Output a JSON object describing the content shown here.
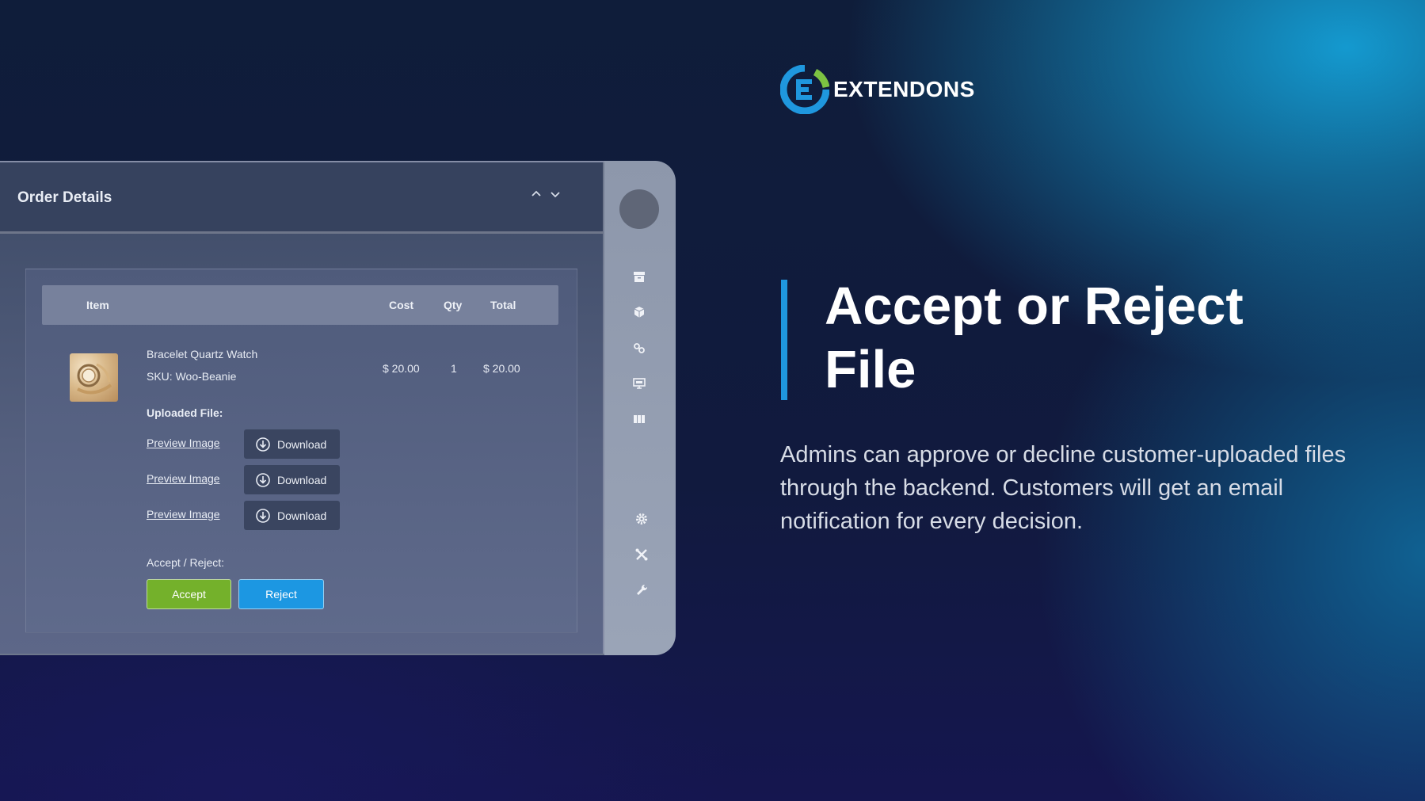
{
  "brand": {
    "name": "EXTENDONS",
    "logo_icon": "extendons-logo-icon",
    "colors": {
      "blue": "#1f97de",
      "green": "#7cc242"
    }
  },
  "hero": {
    "headline_line1": "Accept or Reject",
    "headline_line2": "File",
    "description": "Admins can approve or decline customer-uploaded files through the backend. Customers will get an email notification for every decision."
  },
  "panel": {
    "title": "Order Details",
    "collapse_icon": "chevron-up-icon",
    "expand_icon": "chevron-down-icon",
    "table": {
      "headers": {
        "item": "Item",
        "cost": "Cost",
        "qty": "Qty",
        "total": "Total"
      },
      "row": {
        "name": "Bracelet Quartz Watch",
        "sku": "SKU: Woo-Beanie",
        "cost": "$ 20.00",
        "qty": "1",
        "total": "$ 20.00"
      }
    },
    "uploaded_label": "Uploaded File:",
    "files": [
      {
        "preview": "Preview Image",
        "download": "Download"
      },
      {
        "preview": "Preview Image",
        "download": "Download"
      },
      {
        "preview": "Preview Image",
        "download": "Download"
      }
    ],
    "decision_label": "Accept / Reject:",
    "accept_label": "Accept",
    "reject_label": "Reject",
    "colors": {
      "accept": "#74b12b",
      "reject": "#1c97e2"
    }
  },
  "sidebar": {
    "icons": [
      "archive-icon",
      "cube-icon",
      "link-icon",
      "monitor-icon",
      "grid-icon",
      "gear-icon",
      "cross-tools-icon",
      "wrench-icon"
    ]
  }
}
